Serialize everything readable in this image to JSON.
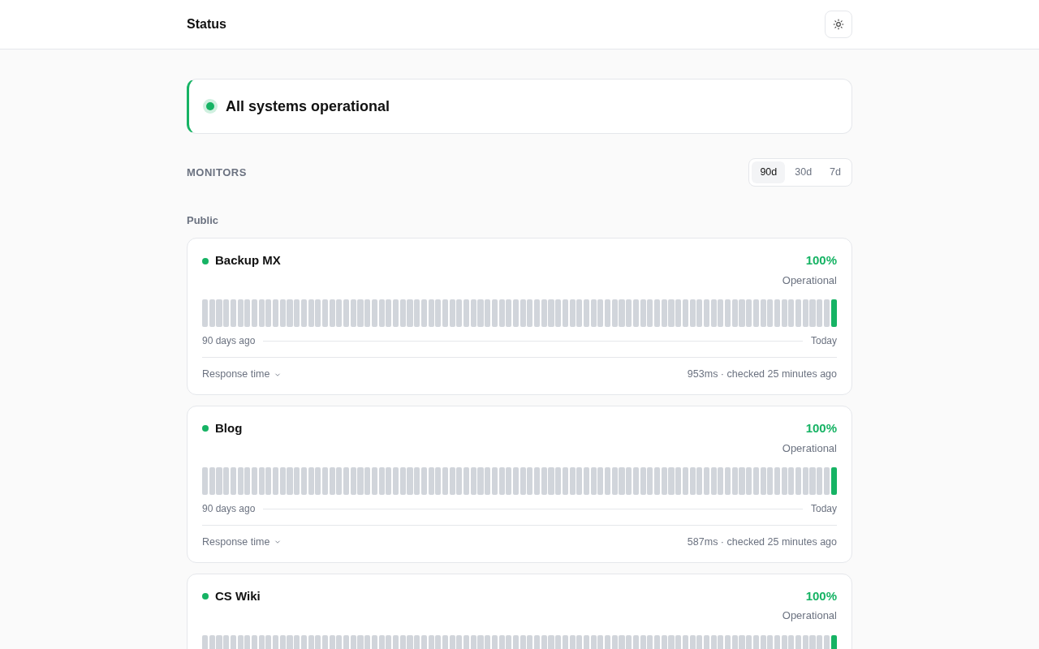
{
  "header": {
    "title": "Status"
  },
  "banner": {
    "color": "#16b364",
    "text": "All systems operational"
  },
  "monitors_section": {
    "heading": "MONITORS",
    "ranges": [
      {
        "label": "90d",
        "selected": true
      },
      {
        "label": "30d",
        "selected": false
      },
      {
        "label": "7d",
        "selected": false
      }
    ]
  },
  "group": {
    "label": "Public"
  },
  "monitors": [
    {
      "name": "Backup MX",
      "color": "#16b364",
      "uptime": "100%",
      "status_text": "Operational",
      "start_label": "90 days ago",
      "end_label": "Today",
      "response_label": "Response time",
      "response_info": "953ms · checked 25 minutes ago",
      "history": [
        {
          "color": "#d1d5db"
        },
        {
          "color": "#d1d5db"
        },
        {
          "color": "#d1d5db"
        },
        {
          "color": "#d1d5db"
        },
        {
          "color": "#d1d5db"
        },
        {
          "color": "#d1d5db"
        },
        {
          "color": "#d1d5db"
        },
        {
          "color": "#d1d5db"
        },
        {
          "color": "#d1d5db"
        },
        {
          "color": "#d1d5db"
        },
        {
          "color": "#d1d5db"
        },
        {
          "color": "#d1d5db"
        },
        {
          "color": "#d1d5db"
        },
        {
          "color": "#d1d5db"
        },
        {
          "color": "#d1d5db"
        },
        {
          "color": "#d1d5db"
        },
        {
          "color": "#d1d5db"
        },
        {
          "color": "#d1d5db"
        },
        {
          "color": "#d1d5db"
        },
        {
          "color": "#d1d5db"
        },
        {
          "color": "#d1d5db"
        },
        {
          "color": "#d1d5db"
        },
        {
          "color": "#d1d5db"
        },
        {
          "color": "#d1d5db"
        },
        {
          "color": "#d1d5db"
        },
        {
          "color": "#d1d5db"
        },
        {
          "color": "#d1d5db"
        },
        {
          "color": "#d1d5db"
        },
        {
          "color": "#d1d5db"
        },
        {
          "color": "#d1d5db"
        },
        {
          "color": "#d1d5db"
        },
        {
          "color": "#d1d5db"
        },
        {
          "color": "#d1d5db"
        },
        {
          "color": "#d1d5db"
        },
        {
          "color": "#d1d5db"
        },
        {
          "color": "#d1d5db"
        },
        {
          "color": "#d1d5db"
        },
        {
          "color": "#d1d5db"
        },
        {
          "color": "#d1d5db"
        },
        {
          "color": "#d1d5db"
        },
        {
          "color": "#d1d5db"
        },
        {
          "color": "#d1d5db"
        },
        {
          "color": "#d1d5db"
        },
        {
          "color": "#d1d5db"
        },
        {
          "color": "#d1d5db"
        },
        {
          "color": "#d1d5db"
        },
        {
          "color": "#d1d5db"
        },
        {
          "color": "#d1d5db"
        },
        {
          "color": "#d1d5db"
        },
        {
          "color": "#d1d5db"
        },
        {
          "color": "#d1d5db"
        },
        {
          "color": "#d1d5db"
        },
        {
          "color": "#d1d5db"
        },
        {
          "color": "#d1d5db"
        },
        {
          "color": "#d1d5db"
        },
        {
          "color": "#d1d5db"
        },
        {
          "color": "#d1d5db"
        },
        {
          "color": "#d1d5db"
        },
        {
          "color": "#d1d5db"
        },
        {
          "color": "#d1d5db"
        },
        {
          "color": "#d1d5db"
        },
        {
          "color": "#d1d5db"
        },
        {
          "color": "#d1d5db"
        },
        {
          "color": "#d1d5db"
        },
        {
          "color": "#d1d5db"
        },
        {
          "color": "#d1d5db"
        },
        {
          "color": "#d1d5db"
        },
        {
          "color": "#d1d5db"
        },
        {
          "color": "#d1d5db"
        },
        {
          "color": "#d1d5db"
        },
        {
          "color": "#d1d5db"
        },
        {
          "color": "#d1d5db"
        },
        {
          "color": "#d1d5db"
        },
        {
          "color": "#d1d5db"
        },
        {
          "color": "#d1d5db"
        },
        {
          "color": "#d1d5db"
        },
        {
          "color": "#d1d5db"
        },
        {
          "color": "#d1d5db"
        },
        {
          "color": "#d1d5db"
        },
        {
          "color": "#d1d5db"
        },
        {
          "color": "#d1d5db"
        },
        {
          "color": "#d1d5db"
        },
        {
          "color": "#d1d5db"
        },
        {
          "color": "#d1d5db"
        },
        {
          "color": "#d1d5db"
        },
        {
          "color": "#d1d5db"
        },
        {
          "color": "#d1d5db"
        },
        {
          "color": "#d1d5db"
        },
        {
          "color": "#d1d5db"
        },
        {
          "color": "#16b364"
        }
      ]
    },
    {
      "name": "Blog",
      "color": "#16b364",
      "uptime": "100%",
      "status_text": "Operational",
      "start_label": "90 days ago",
      "end_label": "Today",
      "response_label": "Response time",
      "response_info": "587ms · checked 25 minutes ago",
      "history": [
        {
          "color": "#d1d5db"
        },
        {
          "color": "#d1d5db"
        },
        {
          "color": "#d1d5db"
        },
        {
          "color": "#d1d5db"
        },
        {
          "color": "#d1d5db"
        },
        {
          "color": "#d1d5db"
        },
        {
          "color": "#d1d5db"
        },
        {
          "color": "#d1d5db"
        },
        {
          "color": "#d1d5db"
        },
        {
          "color": "#d1d5db"
        },
        {
          "color": "#d1d5db"
        },
        {
          "color": "#d1d5db"
        },
        {
          "color": "#d1d5db"
        },
        {
          "color": "#d1d5db"
        },
        {
          "color": "#d1d5db"
        },
        {
          "color": "#d1d5db"
        },
        {
          "color": "#d1d5db"
        },
        {
          "color": "#d1d5db"
        },
        {
          "color": "#d1d5db"
        },
        {
          "color": "#d1d5db"
        },
        {
          "color": "#d1d5db"
        },
        {
          "color": "#d1d5db"
        },
        {
          "color": "#d1d5db"
        },
        {
          "color": "#d1d5db"
        },
        {
          "color": "#d1d5db"
        },
        {
          "color": "#d1d5db"
        },
        {
          "color": "#d1d5db"
        },
        {
          "color": "#d1d5db"
        },
        {
          "color": "#d1d5db"
        },
        {
          "color": "#d1d5db"
        },
        {
          "color": "#d1d5db"
        },
        {
          "color": "#d1d5db"
        },
        {
          "color": "#d1d5db"
        },
        {
          "color": "#d1d5db"
        },
        {
          "color": "#d1d5db"
        },
        {
          "color": "#d1d5db"
        },
        {
          "color": "#d1d5db"
        },
        {
          "color": "#d1d5db"
        },
        {
          "color": "#d1d5db"
        },
        {
          "color": "#d1d5db"
        },
        {
          "color": "#d1d5db"
        },
        {
          "color": "#d1d5db"
        },
        {
          "color": "#d1d5db"
        },
        {
          "color": "#d1d5db"
        },
        {
          "color": "#d1d5db"
        },
        {
          "color": "#d1d5db"
        },
        {
          "color": "#d1d5db"
        },
        {
          "color": "#d1d5db"
        },
        {
          "color": "#d1d5db"
        },
        {
          "color": "#d1d5db"
        },
        {
          "color": "#d1d5db"
        },
        {
          "color": "#d1d5db"
        },
        {
          "color": "#d1d5db"
        },
        {
          "color": "#d1d5db"
        },
        {
          "color": "#d1d5db"
        },
        {
          "color": "#d1d5db"
        },
        {
          "color": "#d1d5db"
        },
        {
          "color": "#d1d5db"
        },
        {
          "color": "#d1d5db"
        },
        {
          "color": "#d1d5db"
        },
        {
          "color": "#d1d5db"
        },
        {
          "color": "#d1d5db"
        },
        {
          "color": "#d1d5db"
        },
        {
          "color": "#d1d5db"
        },
        {
          "color": "#d1d5db"
        },
        {
          "color": "#d1d5db"
        },
        {
          "color": "#d1d5db"
        },
        {
          "color": "#d1d5db"
        },
        {
          "color": "#d1d5db"
        },
        {
          "color": "#d1d5db"
        },
        {
          "color": "#d1d5db"
        },
        {
          "color": "#d1d5db"
        },
        {
          "color": "#d1d5db"
        },
        {
          "color": "#d1d5db"
        },
        {
          "color": "#d1d5db"
        },
        {
          "color": "#d1d5db"
        },
        {
          "color": "#d1d5db"
        },
        {
          "color": "#d1d5db"
        },
        {
          "color": "#d1d5db"
        },
        {
          "color": "#d1d5db"
        },
        {
          "color": "#d1d5db"
        },
        {
          "color": "#d1d5db"
        },
        {
          "color": "#d1d5db"
        },
        {
          "color": "#d1d5db"
        },
        {
          "color": "#d1d5db"
        },
        {
          "color": "#d1d5db"
        },
        {
          "color": "#d1d5db"
        },
        {
          "color": "#d1d5db"
        },
        {
          "color": "#d1d5db"
        },
        {
          "color": "#16b364"
        }
      ]
    },
    {
      "name": "CS Wiki",
      "color": "#16b364",
      "uptime": "100%",
      "status_text": "Operational",
      "history": [
        {
          "color": "#d1d5db"
        },
        {
          "color": "#d1d5db"
        },
        {
          "color": "#d1d5db"
        },
        {
          "color": "#d1d5db"
        },
        {
          "color": "#d1d5db"
        },
        {
          "color": "#d1d5db"
        },
        {
          "color": "#d1d5db"
        },
        {
          "color": "#d1d5db"
        },
        {
          "color": "#d1d5db"
        },
        {
          "color": "#d1d5db"
        },
        {
          "color": "#d1d5db"
        },
        {
          "color": "#d1d5db"
        },
        {
          "color": "#d1d5db"
        },
        {
          "color": "#d1d5db"
        },
        {
          "color": "#d1d5db"
        },
        {
          "color": "#d1d5db"
        },
        {
          "color": "#d1d5db"
        },
        {
          "color": "#d1d5db"
        },
        {
          "color": "#d1d5db"
        },
        {
          "color": "#d1d5db"
        },
        {
          "color": "#d1d5db"
        },
        {
          "color": "#d1d5db"
        },
        {
          "color": "#d1d5db"
        },
        {
          "color": "#d1d5db"
        },
        {
          "color": "#d1d5db"
        },
        {
          "color": "#d1d5db"
        },
        {
          "color": "#d1d5db"
        },
        {
          "color": "#d1d5db"
        },
        {
          "color": "#d1d5db"
        },
        {
          "color": "#d1d5db"
        },
        {
          "color": "#d1d5db"
        },
        {
          "color": "#d1d5db"
        },
        {
          "color": "#d1d5db"
        },
        {
          "color": "#d1d5db"
        },
        {
          "color": "#d1d5db"
        },
        {
          "color": "#d1d5db"
        },
        {
          "color": "#d1d5db"
        },
        {
          "color": "#d1d5db"
        },
        {
          "color": "#d1d5db"
        },
        {
          "color": "#d1d5db"
        },
        {
          "color": "#d1d5db"
        },
        {
          "color": "#d1d5db"
        },
        {
          "color": "#d1d5db"
        },
        {
          "color": "#d1d5db"
        },
        {
          "color": "#d1d5db"
        },
        {
          "color": "#d1d5db"
        },
        {
          "color": "#d1d5db"
        },
        {
          "color": "#d1d5db"
        },
        {
          "color": "#d1d5db"
        },
        {
          "color": "#d1d5db"
        },
        {
          "color": "#d1d5db"
        },
        {
          "color": "#d1d5db"
        },
        {
          "color": "#d1d5db"
        },
        {
          "color": "#d1d5db"
        },
        {
          "color": "#d1d5db"
        },
        {
          "color": "#d1d5db"
        },
        {
          "color": "#d1d5db"
        },
        {
          "color": "#d1d5db"
        },
        {
          "color": "#d1d5db"
        },
        {
          "color": "#d1d5db"
        },
        {
          "color": "#d1d5db"
        },
        {
          "color": "#d1d5db"
        },
        {
          "color": "#d1d5db"
        },
        {
          "color": "#d1d5db"
        },
        {
          "color": "#d1d5db"
        },
        {
          "color": "#d1d5db"
        },
        {
          "color": "#d1d5db"
        },
        {
          "color": "#d1d5db"
        },
        {
          "color": "#d1d5db"
        },
        {
          "color": "#d1d5db"
        },
        {
          "color": "#d1d5db"
        },
        {
          "color": "#d1d5db"
        },
        {
          "color": "#d1d5db"
        },
        {
          "color": "#d1d5db"
        },
        {
          "color": "#d1d5db"
        },
        {
          "color": "#d1d5db"
        },
        {
          "color": "#d1d5db"
        },
        {
          "color": "#d1d5db"
        },
        {
          "color": "#d1d5db"
        },
        {
          "color": "#d1d5db"
        },
        {
          "color": "#d1d5db"
        },
        {
          "color": "#d1d5db"
        },
        {
          "color": "#d1d5db"
        },
        {
          "color": "#d1d5db"
        },
        {
          "color": "#d1d5db"
        },
        {
          "color": "#d1d5db"
        },
        {
          "color": "#d1d5db"
        },
        {
          "color": "#d1d5db"
        },
        {
          "color": "#d1d5db"
        },
        {
          "color": "#16b364"
        }
      ]
    }
  ]
}
